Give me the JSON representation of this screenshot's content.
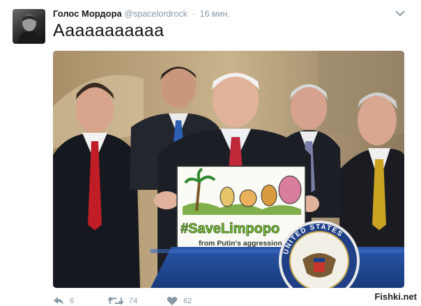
{
  "tweet": {
    "author_name": "Голос Мордора",
    "author_handle": "@spacelordrock",
    "separator": "·",
    "timestamp": "16 мин.",
    "text": "Ааааааааааа"
  },
  "media": {
    "sign_hashtag": "#SaveLimpopo",
    "sign_subtitle": "from Putin's aggression",
    "seal_text": "UNITED STATES"
  },
  "actions": {
    "reply_count": "6",
    "retweet_count": "74",
    "like_count": "62"
  },
  "watermark": "Fishki.net",
  "colors": {
    "text_primary": "#14171a",
    "text_secondary": "#8899a6",
    "podium_blue": "#1f3f86"
  },
  "icons": {
    "reply": "reply-icon",
    "retweet": "retweet-icon",
    "like": "heart-icon",
    "more": "chevron-down-icon"
  }
}
